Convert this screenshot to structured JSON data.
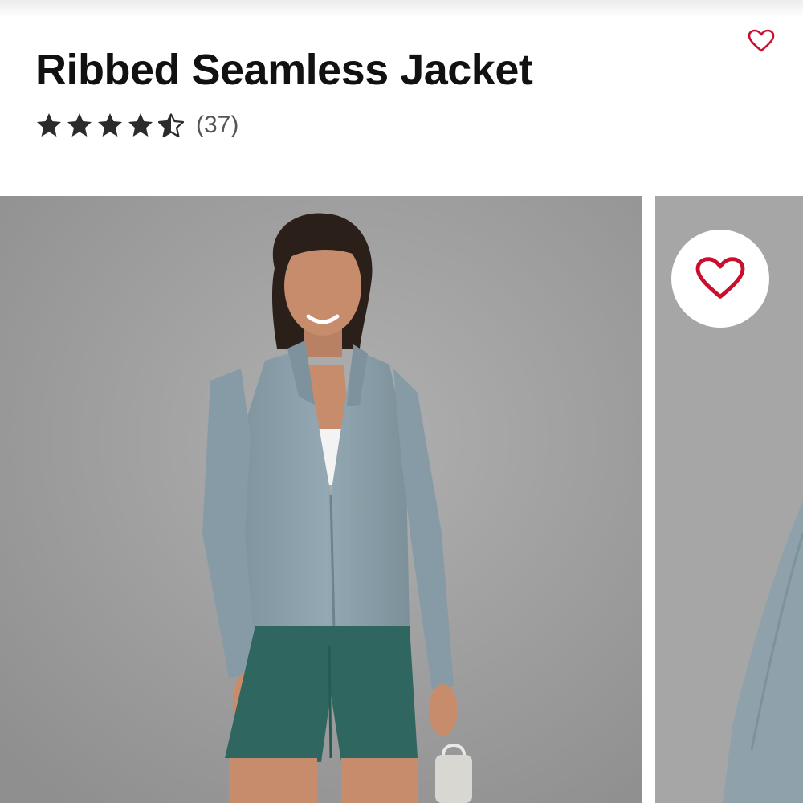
{
  "product": {
    "title": "Ribbed Seamless Jacket",
    "rating": 4.5,
    "max_rating": 5,
    "review_count_text": "(37)"
  },
  "icons": {
    "favorite": "heart-outline-icon",
    "star_full": "star-filled-icon",
    "star_half": "star-half-icon"
  },
  "gallery": {
    "images": [
      {
        "alt": "Model wearing grey-blue ribbed zip-up jacket with green bike shorts, holding a water bottle"
      },
      {
        "alt": "Close-up of jacket sleeve"
      }
    ]
  },
  "colors": {
    "accent_red": "#c8102e",
    "text": "#111111",
    "muted_text": "#555555",
    "photo_backdrop": "#9d9d9d",
    "jacket": "#8ea3ad",
    "shorts": "#2f6760"
  }
}
